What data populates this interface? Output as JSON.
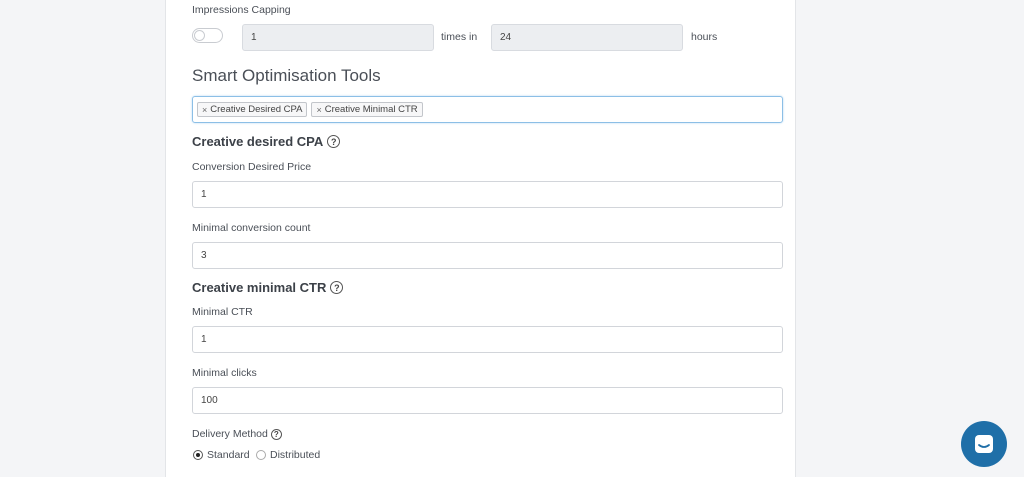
{
  "impressions_capping": {
    "label": "Impressions Capping",
    "times_value": "1",
    "times_label": "times in",
    "hours_value": "24",
    "hours_label": "hours"
  },
  "smart_tools": {
    "title": "Smart Optimisation Tools",
    "tags": [
      "Creative Desired CPA",
      "Creative Minimal CTR"
    ],
    "remove_glyph": "×"
  },
  "creative_cpa": {
    "title": "Creative desired CPA",
    "help_glyph": "?",
    "fields": [
      {
        "label": "Conversion Desired Price",
        "value": "1"
      },
      {
        "label": "Minimal conversion count",
        "value": "3"
      }
    ]
  },
  "creative_ctr": {
    "title": "Creative minimal CTR",
    "help_glyph": "?",
    "fields": [
      {
        "label": "Minimal CTR",
        "value": "1"
      },
      {
        "label": "Minimal clicks",
        "value": "100"
      }
    ]
  },
  "delivery": {
    "label": "Delivery Method",
    "help_glyph": "?",
    "options": [
      "Standard",
      "Distributed"
    ],
    "selected": "Standard"
  },
  "chat_widget": {
    "icon": "chat-icon",
    "color": "#1f6fa8"
  }
}
